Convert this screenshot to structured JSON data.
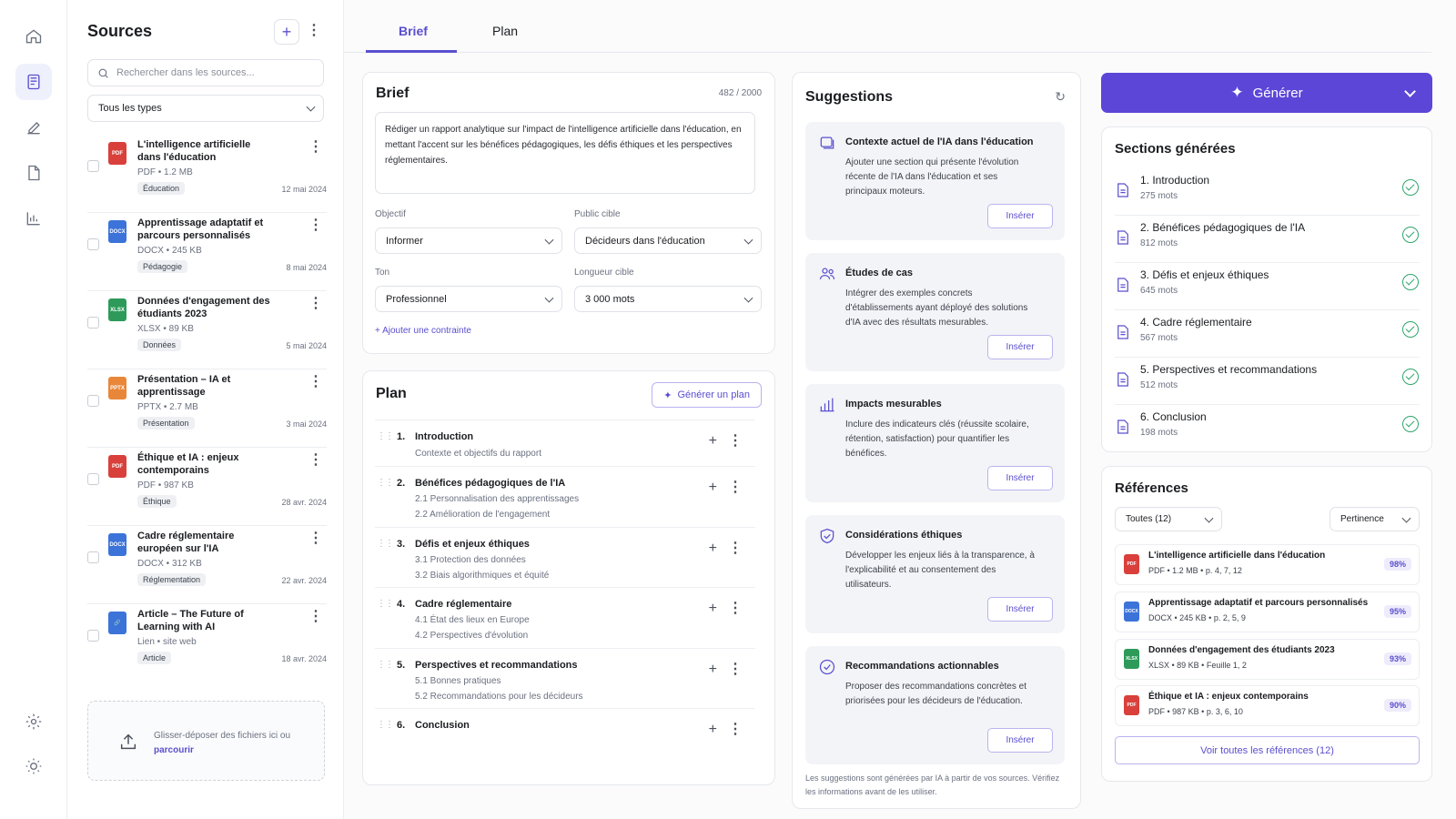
{
  "sources": {
    "title": "Sources",
    "add_label": "+",
    "search_placeholder": "Rechercher dans les sources...",
    "type_filter": "Tous les types",
    "items": [
      {
        "name": "L'intelligence artificielle dans l'éducation",
        "meta": "PDF • 1.2 MB",
        "tag": "Éducation",
        "date": "12 mai 2024",
        "type": "PDF"
      },
      {
        "name": "Apprentissage adaptatif et parcours personnalisés",
        "meta": "DOCX • 245 KB",
        "tag": "Pédagogie",
        "date": "8 mai 2024",
        "type": "DOCX"
      },
      {
        "name": "Données d'engagement des étudiants 2023",
        "meta": "XLSX • 89 KB",
        "tag": "Données",
        "date": "5 mai 2024",
        "type": "XLSX"
      },
      {
        "name": "Présentation – IA et apprentissage",
        "meta": "PPTX • 2.7 MB",
        "tag": "Présentation",
        "date": "3 mai 2024",
        "type": "PPTX"
      },
      {
        "name": "Éthique et IA : enjeux contemporains",
        "meta": "PDF • 987 KB",
        "tag": "Éthique",
        "date": "28 avr. 2024",
        "type": "PDF"
      },
      {
        "name": "Cadre réglementaire européen sur l'IA",
        "meta": "DOCX • 312 KB",
        "tag": "Réglementation",
        "date": "22 avr. 2024",
        "type": "DOCX"
      },
      {
        "name": "Article – The Future of Learning with AI",
        "meta": "Lien • site web",
        "tag": "Article",
        "date": "18 avr. 2024",
        "type": "LINK"
      }
    ],
    "drop_text": "Glisser-déposer des fichiers ici ou",
    "drop_link": "parcourir"
  },
  "tabs": [
    {
      "label": "Brief"
    },
    {
      "label": "Plan"
    }
  ],
  "brief": {
    "title": "Brief",
    "count": "482 / 2000",
    "text": "Rédiger un rapport analytique sur l'impact de l'intelligence artificielle dans l'éducation, en mettant l'accent sur les bénéfices pédagogiques, les défis éthiques et les perspectives réglementaires.",
    "objective_label": "Objectif",
    "objective": "Informer",
    "audience_label": "Public cible",
    "audience": "Décideurs dans l'éducation",
    "tone_label": "Ton",
    "tone": "Professionnel",
    "length_label": "Longueur cible",
    "length": "3 000 mots",
    "add_constraint": "Ajouter une contrainte"
  },
  "plan": {
    "title": "Plan",
    "generate_label": "Générer un plan",
    "rows": [
      {
        "num": "1.",
        "title": "Introduction",
        "subs": [
          "Contexte et objectifs du rapport"
        ]
      },
      {
        "num": "2.",
        "title": "Bénéfices pédagogiques de l'IA",
        "subs": [
          "2.1 Personnalisation des apprentissages",
          "2.2 Amélioration de l'engagement"
        ]
      },
      {
        "num": "3.",
        "title": "Défis et enjeux éthiques",
        "subs": [
          "3.1 Protection des données",
          "3.2 Biais algorithmiques et équité"
        ]
      },
      {
        "num": "4.",
        "title": "Cadre réglementaire",
        "subs": [
          "4.1 État des lieux en Europe",
          "4.2 Perspectives d'évolution"
        ]
      },
      {
        "num": "5.",
        "title": "Perspectives et recommandations",
        "subs": [
          "5.1 Bonnes pratiques",
          "5.2 Recommandations pour les décideurs"
        ]
      },
      {
        "num": "6.",
        "title": "Conclusion",
        "subs": []
      }
    ]
  },
  "suggestions": {
    "title": "Suggestions",
    "insert_label": "Insérer",
    "items": [
      {
        "icon": "layers-icon",
        "title": "Contexte actuel de l'IA dans l'éducation",
        "desc": "Ajouter une section qui présente l'évolution récente de l'IA dans l'éducation et ses principaux moteurs."
      },
      {
        "icon": "users-icon",
        "title": "Études de cas",
        "desc": "Intégrer des exemples concrets d'établissements ayant déployé des solutions d'IA avec des résultats mesurables."
      },
      {
        "icon": "bar-chart-icon",
        "title": "Impacts mesurables",
        "desc": "Inclure des indicateurs clés (réussite scolaire, rétention, satisfaction) pour quantifier les bénéfices."
      },
      {
        "icon": "shield-check-icon",
        "title": "Considérations éthiques",
        "desc": "Développer les enjeux liés à la transparence, à l'explicabilité et au consentement des utilisateurs."
      },
      {
        "icon": "check-circle-icon",
        "title": "Recommandations actionnables",
        "desc": "Proposer des recommandations concrètes et priorisées pour les décideurs de l'éducation."
      }
    ],
    "footnote": "Les suggestions sont générées par IA à partir de vos sources. Vérifiez les informations avant de les utiliser."
  },
  "generate": {
    "label": "Générer"
  },
  "sections": {
    "title": "Sections générées",
    "items": [
      {
        "title": "1. Introduction",
        "words": "275 mots"
      },
      {
        "title": "2. Bénéfices pédagogiques de l'IA",
        "words": "812 mots"
      },
      {
        "title": "3. Défis et enjeux éthiques",
        "words": "645 mots"
      },
      {
        "title": "4. Cadre réglementaire",
        "words": "567 mots"
      },
      {
        "title": "5. Perspectives et recommandations",
        "words": "512 mots"
      },
      {
        "title": "6. Conclusion",
        "words": "198 mots"
      }
    ]
  },
  "references": {
    "title": "Références",
    "filter": "Toutes (12)",
    "sort": "Pertinence",
    "items": [
      {
        "title": "L'intelligence artificielle dans l'éducation",
        "meta": "PDF • 1.2 MB • p. 4, 7, 12",
        "pct": "98%",
        "type": "PDF"
      },
      {
        "title": "Apprentissage adaptatif et parcours personnalisés",
        "meta": "DOCX • 245 KB • p. 2, 5, 9",
        "pct": "95%",
        "type": "DOCX"
      },
      {
        "title": "Données d'engagement des étudiants 2023",
        "meta": "XLSX • 89 KB • Feuille 1, 2",
        "pct": "93%",
        "type": "XLSX"
      },
      {
        "title": "Éthique et IA : enjeux contemporains",
        "meta": "PDF • 987 KB • p. 3, 6, 10",
        "pct": "90%",
        "type": "PDF"
      }
    ],
    "view_all": "Voir toutes les références (12)"
  },
  "colors": {
    "accent": "#5b46d8",
    "success": "#2fa66b"
  }
}
